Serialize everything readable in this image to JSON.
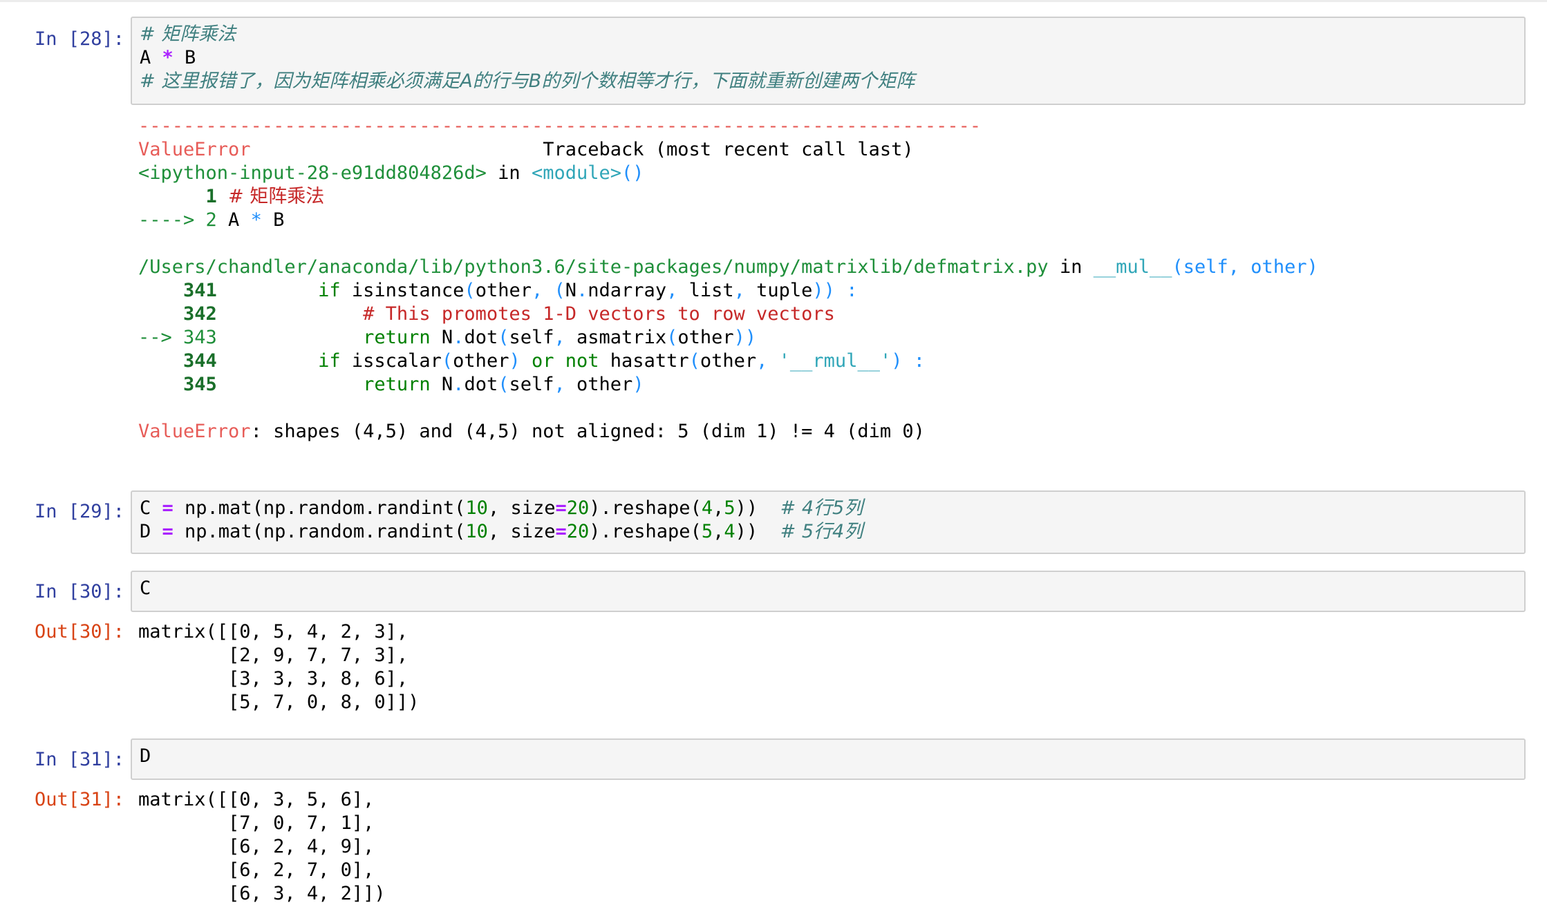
{
  "cells": {
    "c28": {
      "prompt": "In [28]:",
      "line1": "# 矩阵乘法",
      "line2_a": "A ",
      "line2_op": "*",
      "line2_b": " B",
      "line3": "# 这里报错了，因为矩阵相乘必须满足A的行与B的列个数相等才行，下面就重新创建两个矩阵"
    },
    "tb": {
      "dashes": "---------------------------------------------------------------------------",
      "err_name": "ValueError",
      "header_right": "                          Traceback (most recent call last)",
      "input_name": "<ipython-input-28-e91dd804826d>",
      "in_word": " in ",
      "module": "<module>",
      "module_parens": "()",
      "l1_num": "      1 ",
      "l1_text": "# 矩阵乘法",
      "l2_arrow": "----> 2 ",
      "l2_a": "A ",
      "l2_op": "*",
      "l2_b": " B",
      "path": "/Users/chandler/anaconda/lib/python3.6/site-packages/numpy/matrixlib/defmatrix.py",
      "func": "__mul__",
      "func_args": "(self, other)",
      "n341": "    341 ",
      "t341a": "        if ",
      "t341b": "isinstance",
      "t341c": "(",
      "t341d": "other",
      "t341e": ", (",
      "t341f": "N",
      "t341g": ".",
      "t341h": "ndarray",
      "t341i": ", ",
      "t341j": "list",
      "t341k": ", ",
      "t341l": "tuple",
      "t341m": ")) :",
      "n342": "    342 ",
      "t342": "            # This promotes 1-D vectors to row vectors",
      "n343": "--> 343 ",
      "t343a": "            return ",
      "t343b": "N",
      "t343c": ".",
      "t343d": "dot",
      "t343e": "(",
      "t343f": "self",
      "t343g": ", ",
      "t343h": "asmatrix",
      "t343i": "(",
      "t343j": "other",
      "t343k": "))",
      "n344": "    344 ",
      "t344a": "        if ",
      "t344b": "isscalar",
      "t344c": "(",
      "t344d": "other",
      "t344e": ") ",
      "t344f": "or",
      "t344g": " ",
      "t344h": "not",
      "t344i": " ",
      "t344j": "hasattr",
      "t344k": "(",
      "t344l": "other",
      "t344m": ", ",
      "t344n": "'__rmul__'",
      "t344o": ") :",
      "n345": "    345 ",
      "t345a": "            return ",
      "t345b": "N",
      "t345c": ".",
      "t345d": "dot",
      "t345e": "(",
      "t345f": "self",
      "t345g": ", ",
      "t345h": "other",
      "t345i": ")",
      "final_name": "ValueError",
      "final_msg": ": shapes (4,5) and (4,5) not aligned: 5 (dim 1) != 4 (dim 0)"
    },
    "c29": {
      "prompt": "In [29]:",
      "l1_a": "C ",
      "l1_eq": "=",
      "l1_b": " np.mat(np.random.randint(",
      "l1_n1": "10",
      "l1_c": ", size",
      "l1_eq2": "=",
      "l1_n2": "20",
      "l1_d": ").reshape(",
      "l1_n3": "4",
      "l1_e": ",",
      "l1_n4": "5",
      "l1_f": "))  ",
      "l1_cm": "# 4行5列",
      "l2_a": "D ",
      "l2_eq": "=",
      "l2_b": " np.mat(np.random.randint(",
      "l2_n1": "10",
      "l2_c": ", size",
      "l2_eq2": "=",
      "l2_n2": "20",
      "l2_d": ").reshape(",
      "l2_n3": "5",
      "l2_e": ",",
      "l2_n4": "4",
      "l2_f": "))  ",
      "l2_cm": "# 5行4列"
    },
    "c30": {
      "prompt": "In [30]:",
      "code": "C",
      "out_prompt": "Out[30]:",
      "out_lines": [
        "matrix([[0, 5, 4, 2, 3],",
        "        [2, 9, 7, 7, 3],",
        "        [3, 3, 3, 8, 6],",
        "        [5, 7, 0, 8, 0]])"
      ]
    },
    "c31": {
      "prompt": "In [31]:",
      "code": "D",
      "out_prompt": "Out[31]:",
      "out_lines": [
        "matrix([[0, 3, 5, 6],",
        "        [7, 0, 7, 1],",
        "        [6, 2, 4, 9],",
        "        [6, 2, 7, 0],",
        "        [6, 3, 4, 2]])"
      ]
    }
  }
}
